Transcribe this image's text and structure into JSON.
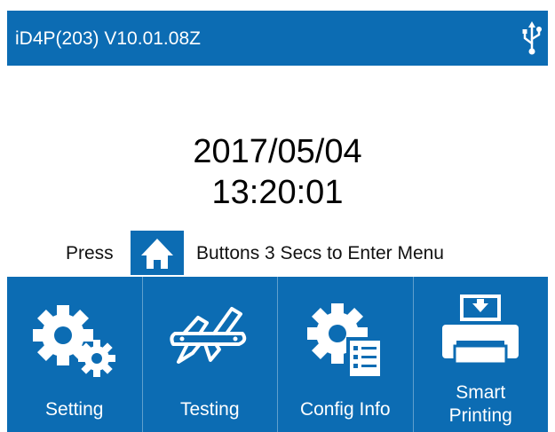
{
  "status_bar": {
    "title": "iD4P(203) V10.01.08Z",
    "usb_icon": "usb-icon"
  },
  "clock": {
    "date": "2017/05/04",
    "time": "13:20:01"
  },
  "hint": {
    "press": "Press",
    "button_icon": "home-icon",
    "rest": "Buttons 3 Secs to Enter Menu"
  },
  "menu": {
    "items": [
      {
        "label": "Setting",
        "icon": "gears-icon"
      },
      {
        "label": "Testing",
        "icon": "multitool-icon"
      },
      {
        "label": "Config Info",
        "icon": "config-list-icon"
      },
      {
        "label": "Smart\nPrinting",
        "icon": "printer-icon"
      }
    ]
  },
  "colors": {
    "accent": "#0c6cb3",
    "text": "#000000",
    "on_accent": "#ffffff"
  }
}
